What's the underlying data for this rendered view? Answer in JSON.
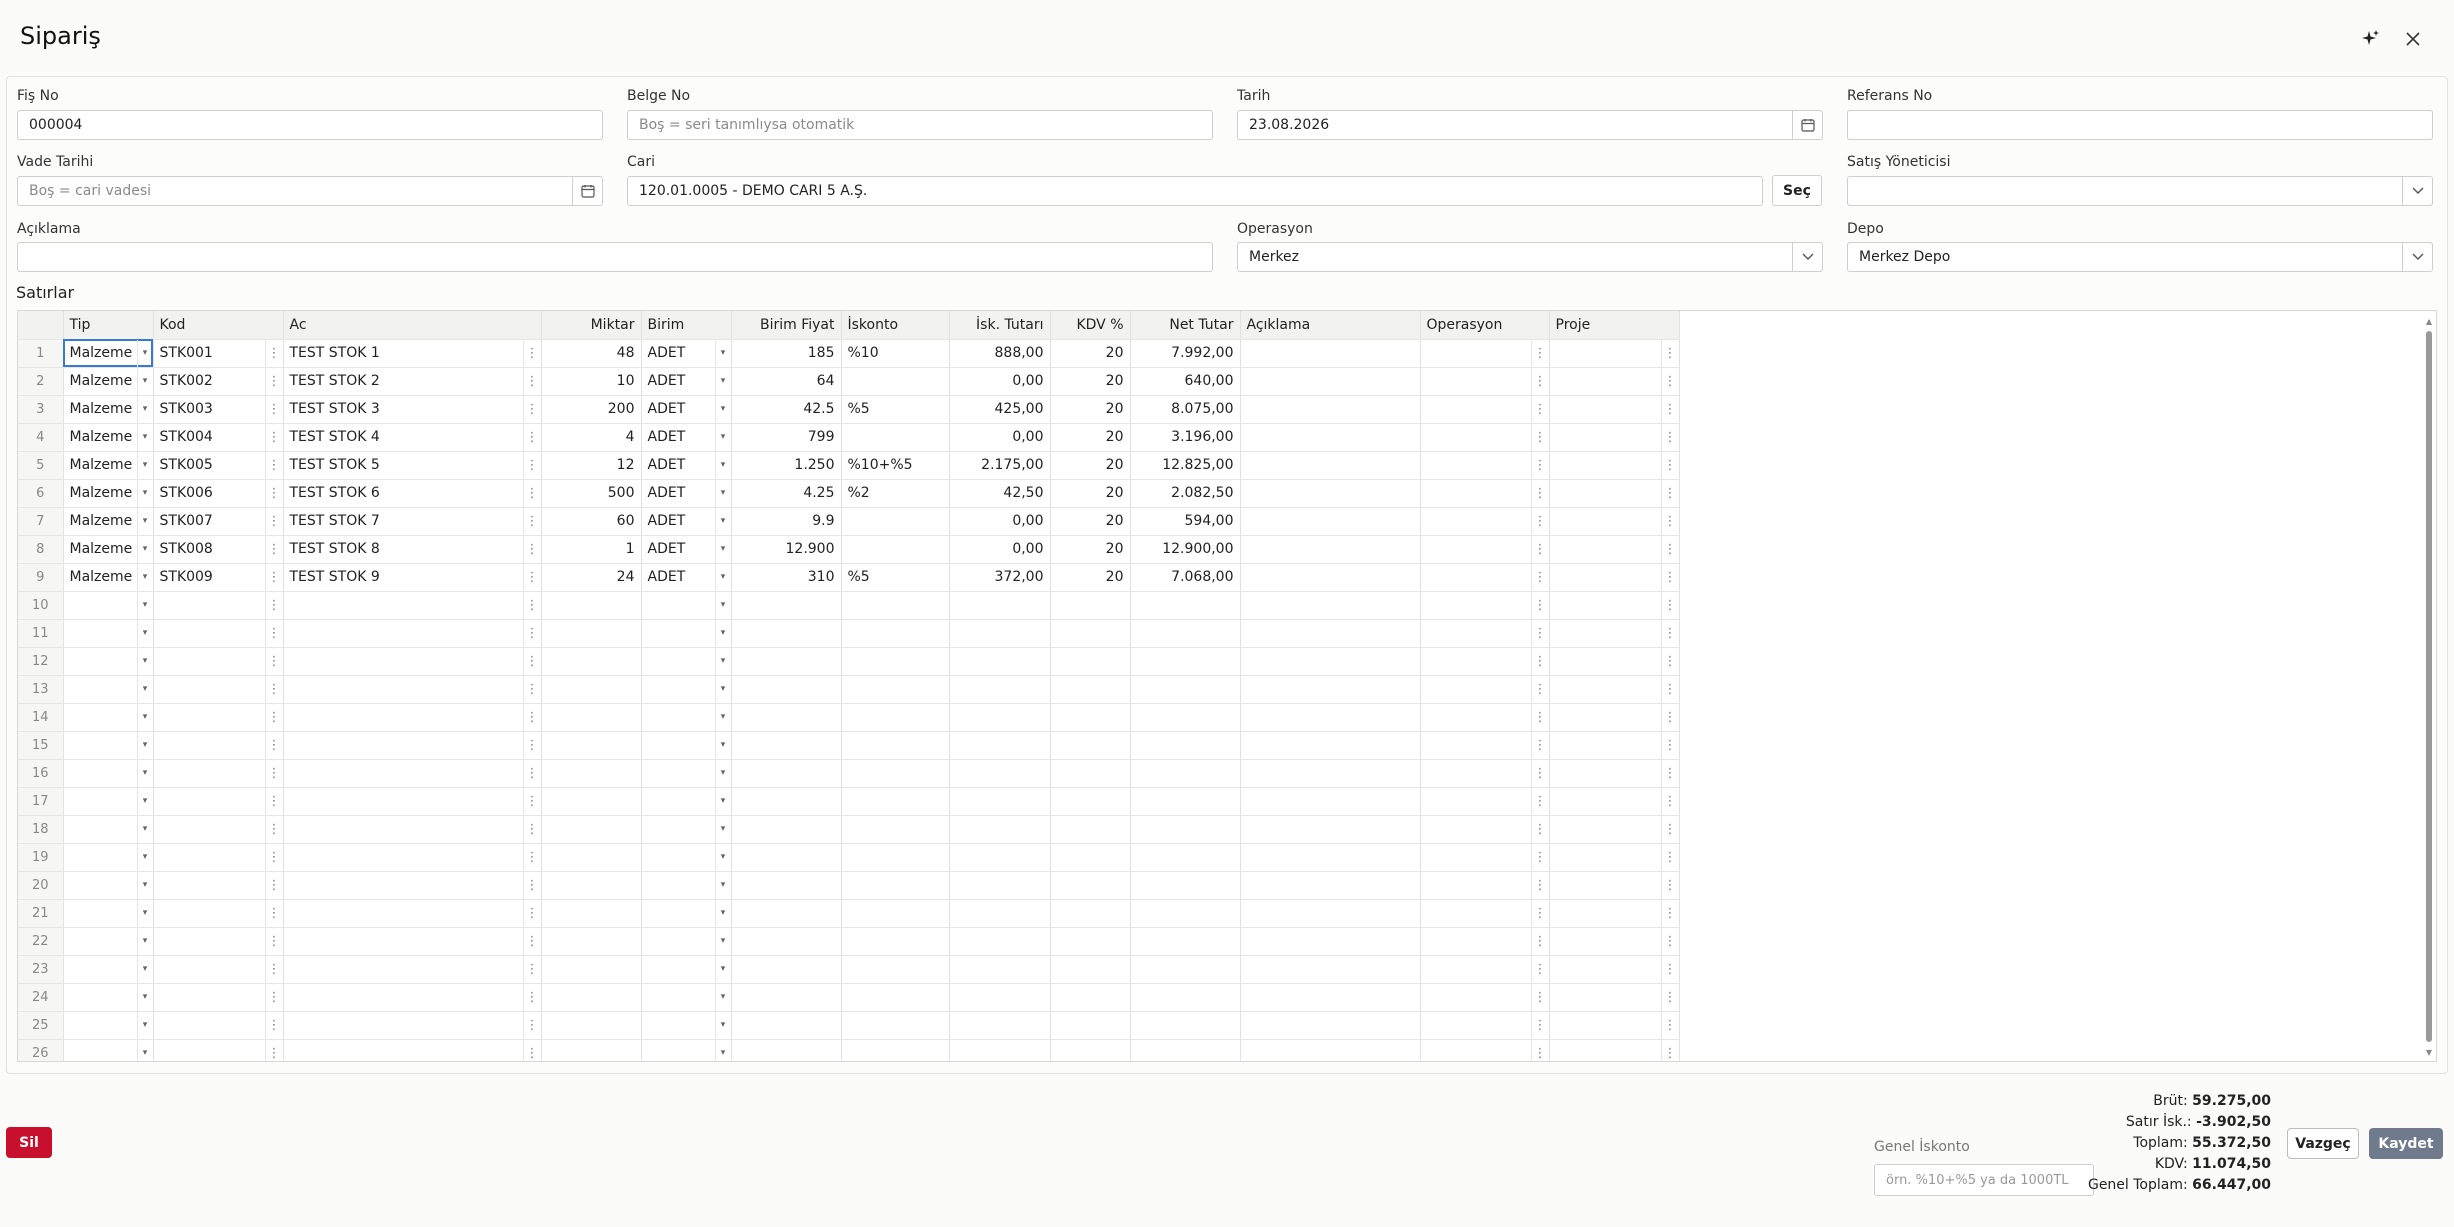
{
  "window": {
    "title": "Sipariş"
  },
  "header": {
    "sparkle_icon": "sparkle-icon",
    "close_icon": "close-icon"
  },
  "form": {
    "fis_no": {
      "label": "Fiş No",
      "value": "000004"
    },
    "belge_no": {
      "label": "Belge No",
      "placeholder": "Boş = seri tanımlıysa otomatik"
    },
    "tarih": {
      "label": "Tarih",
      "value": "23.08.2026"
    },
    "referans_no": {
      "label": "Referans No",
      "value": ""
    },
    "vade_tarihi": {
      "label": "Vade Tarihi",
      "placeholder": "Boş = cari vadesi"
    },
    "cari": {
      "label": "Cari",
      "value": "120.01.0005 - DEMO CARI 5 A.Ş.",
      "button": "Seç"
    },
    "satis_yoneticisi": {
      "label": "Satış Yöneticisi",
      "value": ""
    },
    "aciklama": {
      "label": "Açıklama",
      "value": ""
    },
    "operasyon": {
      "label": "Operasyon",
      "value": "Merkez"
    },
    "depo": {
      "label": "Depo",
      "value": "Merkez Depo"
    }
  },
  "grid": {
    "section_title": "Satırlar",
    "columns": [
      "Tip",
      "Kod",
      "Ac",
      "Miktar",
      "Birim",
      "Birim Fiyat",
      "İskonto",
      "İsk. Tutarı",
      "KDV %",
      "Net Tutar",
      "Açıklama",
      "Operasyon",
      "Proje"
    ],
    "rows": [
      {
        "n": "1",
        "tip": "Malzeme",
        "kod": "STK001",
        "ac": "TEST STOK 1",
        "miktar": "48",
        "birim": "ADET",
        "fiyat": "185",
        "iskonto": "%10",
        "isk_tutar": "888,00",
        "kdv": "20",
        "net": "7.992,00"
      },
      {
        "n": "2",
        "tip": "Malzeme",
        "kod": "STK002",
        "ac": "TEST STOK 2",
        "miktar": "10",
        "birim": "ADET",
        "fiyat": "64",
        "iskonto": "",
        "isk_tutar": "0,00",
        "kdv": "20",
        "net": "640,00"
      },
      {
        "n": "3",
        "tip": "Malzeme",
        "kod": "STK003",
        "ac": "TEST STOK 3",
        "miktar": "200",
        "birim": "ADET",
        "fiyat": "42.5",
        "iskonto": "%5",
        "isk_tutar": "425,00",
        "kdv": "20",
        "net": "8.075,00"
      },
      {
        "n": "4",
        "tip": "Malzeme",
        "kod": "STK004",
        "ac": "TEST STOK 4",
        "miktar": "4",
        "birim": "ADET",
        "fiyat": "799",
        "iskonto": "",
        "isk_tutar": "0,00",
        "kdv": "20",
        "net": "3.196,00"
      },
      {
        "n": "5",
        "tip": "Malzeme",
        "kod": "STK005",
        "ac": "TEST STOK 5",
        "miktar": "12",
        "birim": "ADET",
        "fiyat": "1.250",
        "iskonto": "%10+%5",
        "isk_tutar": "2.175,00",
        "kdv": "20",
        "net": "12.825,00"
      },
      {
        "n": "6",
        "tip": "Malzeme",
        "kod": "STK006",
        "ac": "TEST STOK 6",
        "miktar": "500",
        "birim": "ADET",
        "fiyat": "4.25",
        "iskonto": "%2",
        "isk_tutar": "42,50",
        "kdv": "20",
        "net": "2.082,50"
      },
      {
        "n": "7",
        "tip": "Malzeme",
        "kod": "STK007",
        "ac": "TEST STOK 7",
        "miktar": "60",
        "birim": "ADET",
        "fiyat": "9.9",
        "iskonto": "",
        "isk_tutar": "0,00",
        "kdv": "20",
        "net": "594,00"
      },
      {
        "n": "8",
        "tip": "Malzeme",
        "kod": "STK008",
        "ac": "TEST STOK 8",
        "miktar": "1",
        "birim": "ADET",
        "fiyat": "12.900",
        "iskonto": "",
        "isk_tutar": "0,00",
        "kdv": "20",
        "net": "12.900,00"
      },
      {
        "n": "9",
        "tip": "Malzeme",
        "kod": "STK009",
        "ac": "TEST STOK 9",
        "miktar": "24",
        "birim": "ADET",
        "fiyat": "310",
        "iskonto": "%5",
        "isk_tutar": "372,00",
        "kdv": "20",
        "net": "7.068,00"
      }
    ],
    "empty_row_numbers": [
      "10",
      "11",
      "12",
      "13",
      "14",
      "15",
      "16",
      "17",
      "18",
      "19",
      "20",
      "21",
      "22",
      "23",
      "24",
      "25",
      "26"
    ]
  },
  "footer": {
    "delete_label": "Sil",
    "genel_iskonto": {
      "label": "Genel İskonto",
      "placeholder": "örn. %10+%5 ya da 1000TL"
    },
    "totals": {
      "brut_label": "Brüt:",
      "brut": "59.275,00",
      "satir_isk_label": "Satır İsk.:",
      "satir_isk": "-3.902,50",
      "toplam_label": "Toplam:",
      "toplam": "55.372,50",
      "kdv_label": "KDV:",
      "kdv": "11.074,50",
      "genel_toplam_label": "Genel Toplam:",
      "genel_toplam": "66.447,00"
    },
    "cancel_label": "Vazgeç",
    "save_label": "Kaydet"
  },
  "colors": {
    "accent": "#3a78d6",
    "danger": "#c8102e",
    "save": "#6f7b8d"
  }
}
